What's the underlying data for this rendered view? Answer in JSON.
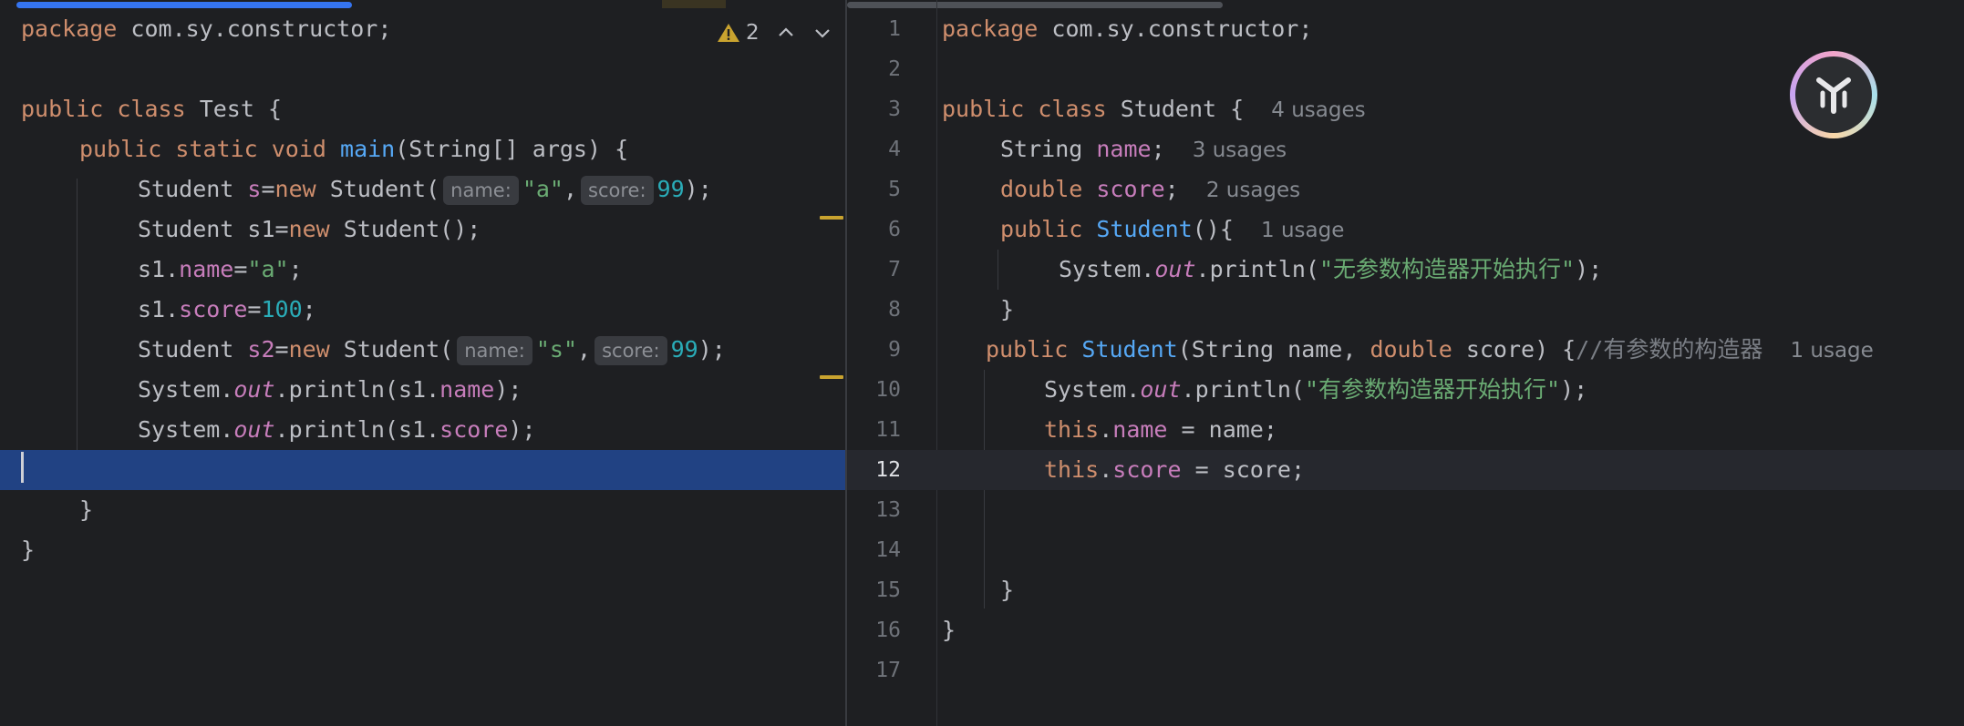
{
  "left_editor": {
    "lines": {
      "l1": {
        "pkg_kw": "package",
        "pkg_name": " com.sy.constructor;"
      },
      "l3": {
        "kw1": "public",
        "kw2": "class",
        "name": " Test {"
      },
      "l4": {
        "kw1": "public",
        "kw2": "static",
        "kw3": "void",
        "fn": "main",
        "rest": "(String[] args) {"
      },
      "l5": {
        "t1": "Student ",
        "var": "s",
        "t2": "=",
        "kw": "new",
        "t3": " Student(",
        "hint1": "name:",
        "str1": "\"a\"",
        "t4": ",",
        "hint2": "score:",
        "num": "99",
        "t5": ");"
      },
      "l6": {
        "t1": "Student s1=",
        "kw": "new",
        "t2": " Student();"
      },
      "l7": {
        "t1": "s1.",
        "fld": "name",
        "t2": "=",
        "str": "\"a\"",
        "t3": ";"
      },
      "l8": {
        "t1": "s1.",
        "fld": "score",
        "t2": "=",
        "num": "100",
        "t3": ";"
      },
      "l9": {
        "t1": "Student ",
        "var": "s2",
        "t2": "=",
        "kw": "new",
        "t3": " Student(",
        "hint1": "name:",
        "str1": "\"s\"",
        "t4": ",",
        "hint2": "score:",
        "num": "99",
        "t5": ");"
      },
      "l10": {
        "t1": "System.",
        "static": "out",
        "t2": ".println(s1.",
        "fld": "name",
        "t3": ");"
      },
      "l11": {
        "t1": "System.",
        "static": "out",
        "t2": ".println(s1.",
        "fld": "score",
        "t3": ");"
      },
      "l13": {
        "t": "}"
      },
      "l14": {
        "t": "}"
      }
    },
    "toolbar": {
      "warning_count": "2"
    }
  },
  "right_editor": {
    "line_numbers": [
      "1",
      "2",
      "3",
      "4",
      "5",
      "6",
      "7",
      "8",
      "9",
      "10",
      "11",
      "12",
      "13",
      "14",
      "15",
      "16",
      "17"
    ],
    "lines": {
      "l1": {
        "pkg_kw": "package",
        "pkg_name": " com.sy.constructor;"
      },
      "l3": {
        "kw1": "public",
        "kw2": "class",
        "name": " Student {",
        "usage": "4 usages"
      },
      "l4": {
        "t1": "String ",
        "fld": "name",
        "t2": ";",
        "usage": "3 usages"
      },
      "l5": {
        "kw": "double",
        "fld": "score",
        "t2": ";",
        "usage": "2 usages"
      },
      "l6": {
        "kw": "public",
        "fn": "Student",
        "t2": "(){",
        "usage": "1 usage"
      },
      "l7": {
        "t1": "System.",
        "static": "out",
        "t2": ".println(",
        "str": "\"无参数构造器开始执行\"",
        "t3": ");"
      },
      "l8": {
        "t": "}"
      },
      "l9": {
        "kw": "public",
        "fn": "Student",
        "t1": "(String name, ",
        "kw2": "double",
        "t2": " score) {",
        "cmt": "//有参数的构造器",
        "usage": "1 usage"
      },
      "l10": {
        "t1": "System.",
        "static": "out",
        "t2": ".println(",
        "str": "\"有参数构造器开始执行\"",
        "t3": ");"
      },
      "l11": {
        "kw": "this",
        "t1": ".",
        "fld": "name",
        "t2": " = name;"
      },
      "l12": {
        "kw": "this",
        "t1": ".",
        "fld": "score",
        "t2": " = score;"
      },
      "l15": {
        "t": "}"
      },
      "l16": {
        "t": "}"
      }
    }
  },
  "colors": {
    "background": "#1e1f22",
    "keyword": "#cf8e6d",
    "function": "#56a8f5",
    "field": "#c77dbb",
    "string": "#6aab73",
    "number": "#2aacb8",
    "selection": "#214283",
    "warning": "#c9a32f"
  },
  "icons": [
    "warning-icon",
    "chevron-up-icon",
    "chevron-down-icon",
    "ai-assistant-icon"
  ]
}
